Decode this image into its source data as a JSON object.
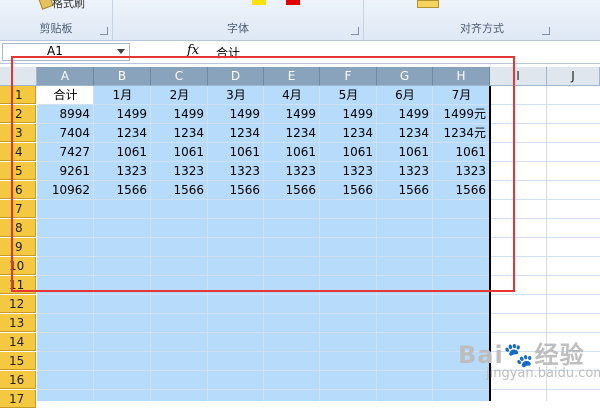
{
  "ribbon": {
    "clipboard_label": "剪贴板",
    "format_painter": "格式刷",
    "font_label": "字体",
    "align_label": "对齐方式"
  },
  "formula_bar": {
    "name_box": "A1",
    "fx": "fx",
    "value": "合计"
  },
  "columns": [
    "A",
    "B",
    "C",
    "D",
    "E",
    "F",
    "G",
    "H",
    "I",
    "J"
  ],
  "rows": [
    "1",
    "2",
    "3",
    "4",
    "5",
    "6",
    "7",
    "8",
    "9",
    "10",
    "11",
    "12",
    "13",
    "14",
    "15",
    "16",
    "17"
  ],
  "table": {
    "header": [
      "合计",
      "1月",
      "2月",
      "3月",
      "4月",
      "5月",
      "6月",
      "7月"
    ],
    "data": [
      [
        "8994",
        "1499",
        "1499",
        "1499",
        "1499",
        "1499",
        "1499",
        "1499元"
      ],
      [
        "7404",
        "1234",
        "1234",
        "1234",
        "1234",
        "1234",
        "1234",
        "1234元"
      ],
      [
        "7427",
        "1061",
        "1061",
        "1061",
        "1061",
        "1061",
        "1061",
        "1061"
      ],
      [
        "9261",
        "1323",
        "1323",
        "1323",
        "1323",
        "1323",
        "1323",
        "1323"
      ],
      [
        "10962",
        "1566",
        "1566",
        "1566",
        "1566",
        "1566",
        "1566",
        "1566"
      ]
    ]
  },
  "watermark": {
    "main": "Bai🐾经验",
    "sub": "jingyan.baidu.com"
  },
  "colors": {
    "selection": "#b7dbfb",
    "row_header_selected": "#f5c842",
    "annotation": "#e53636"
  }
}
